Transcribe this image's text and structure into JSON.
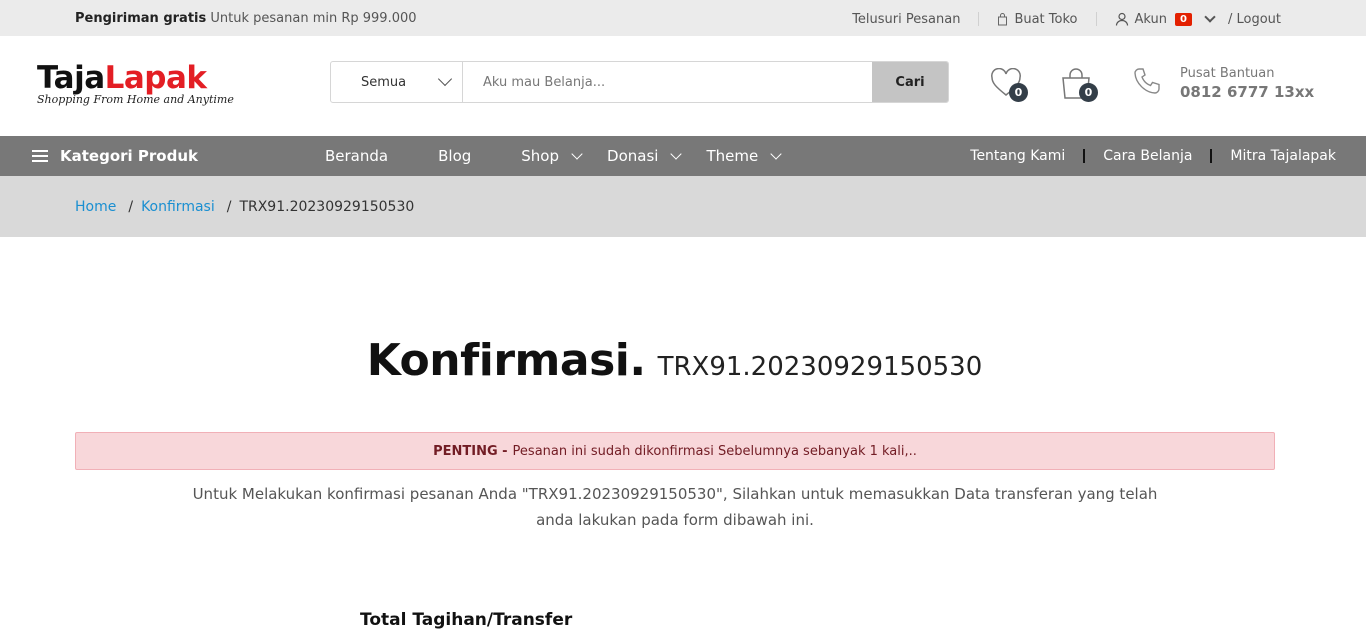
{
  "topbar": {
    "free_bold": "Pengiriman gratis",
    "free_text": "Untuk pesanan min Rp 999.000",
    "track_order": "Telusuri Pesanan",
    "create_store": "Buat Toko",
    "account": "Akun",
    "account_badge": "0",
    "logout": "/ Logout"
  },
  "logo": {
    "part1": "Taja",
    "part2": "Lapak",
    "tagline": "Shopping From Home and Anytime"
  },
  "search": {
    "category": "Semua",
    "placeholder": "Aku mau Belanja...",
    "button": "Cari"
  },
  "header": {
    "wishlist_count": "0",
    "cart_count": "0",
    "help_title": "Pusat Bantuan",
    "help_phone": "0812 6777 13xx"
  },
  "nav": {
    "categories": "Kategori Produk",
    "items": [
      "Beranda",
      "Blog",
      "Shop",
      "Donasi",
      "Theme"
    ],
    "right": [
      "Tentang Kami",
      "Cara Belanja",
      "Mitra Tajalapak"
    ]
  },
  "breadcrumb": {
    "home": "Home",
    "confirm": "Konfirmasi",
    "current": "TRX91.20230929150530"
  },
  "main": {
    "title": "Konfirmasi.",
    "trx": "TRX91.20230929150530",
    "alert_bold": "PENTING -",
    "alert_text": "Pesanan ini sudah dikonfirmasi Sebelumnya sebanyak 1 kali,..",
    "desc": "Untuk Melakukan konfirmasi pesanan Anda \"TRX91.20230929150530\", Silahkan untuk memasukkan Data transferan yang telah anda lakukan pada form dibawah ini.",
    "total_label": "Total Tagihan/Transfer"
  },
  "colors": {
    "accent_red": "#e31e24",
    "nav_bg": "#787878",
    "link_blue": "#1a8fd1",
    "alert_bg": "#f8d7da"
  }
}
